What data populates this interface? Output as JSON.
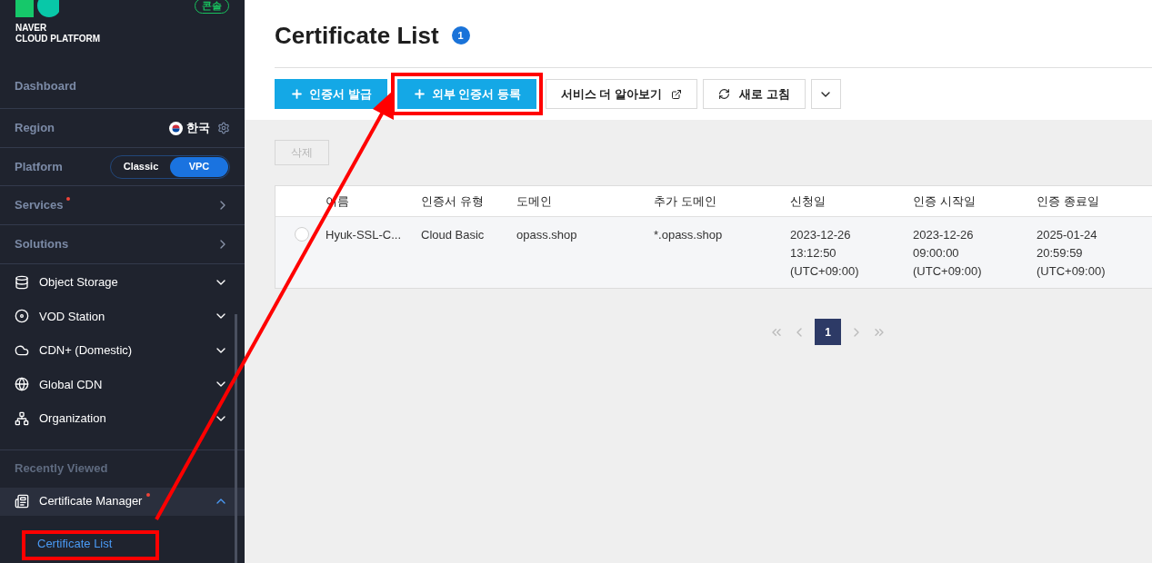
{
  "sidebar": {
    "logo": {
      "line_1": "NAVER",
      "line_2": "CLOUD PLATFORM"
    },
    "console_badge": "콘솔",
    "dashboard": "Dashboard",
    "region": {
      "label": "Region",
      "value": "한국"
    },
    "platform": {
      "label": "Platform",
      "options": [
        {
          "label": "Classic",
          "selected": false
        },
        {
          "label": "VPC",
          "selected": true
        }
      ]
    },
    "nav": [
      {
        "label": "Services",
        "dot": true
      },
      {
        "label": "Solutions",
        "dot": false
      }
    ],
    "services": [
      {
        "label": "Object Storage",
        "kind": "storage",
        "expanded": false
      },
      {
        "label": "VOD Station",
        "kind": "vod",
        "expanded": false
      },
      {
        "label": "CDN+ (Domestic)",
        "kind": "cdn",
        "expanded": false
      },
      {
        "label": "Global CDN",
        "kind": "globe",
        "expanded": false
      },
      {
        "label": "Organization",
        "kind": "org",
        "expanded": false
      }
    ],
    "recent_heading": "Recently Viewed",
    "recent": [
      {
        "label": "Certificate Manager",
        "dot": true,
        "expanded": true,
        "children": [
          {
            "label": "Certificate List",
            "selected": true,
            "highlighted": true
          }
        ]
      }
    ]
  },
  "page": {
    "title": "Certificate List",
    "count": "1"
  },
  "toolbar": [
    {
      "label": "인증서 발급",
      "kind": "primary",
      "highlighted": false
    },
    {
      "label": "외부 인증서 등록",
      "kind": "primary",
      "highlighted": true
    },
    {
      "label": "서비스 더 알아보기",
      "kind": "external",
      "highlighted": false
    },
    {
      "label": "새로 고침",
      "kind": "refresh",
      "highlighted": false
    },
    {
      "kind": "more",
      "highlighted": false
    }
  ],
  "delete_button": {
    "label": "삭제",
    "disabled": true
  },
  "table": {
    "columns": [
      "이름",
      "인증서 유형",
      "도메인",
      "추가 도메인",
      "신청일",
      "인증 시작일",
      "인증 종료일"
    ],
    "rows": [
      {
        "selected": false,
        "cells": [
          "Hyuk-SSL-C...",
          "Cloud Basic",
          "opass.shop",
          "*.opass.shop",
          "2023-12-26\n13:12:50\n(UTC+09:00)",
          "2023-12-26\n09:00:00\n(UTC+09:00)",
          "2025-01-24\n20:59:59\n(UTC+09:00)"
        ]
      }
    ]
  },
  "pagination": {
    "pages": [
      {
        "label": "1",
        "selected": true
      }
    ]
  }
}
